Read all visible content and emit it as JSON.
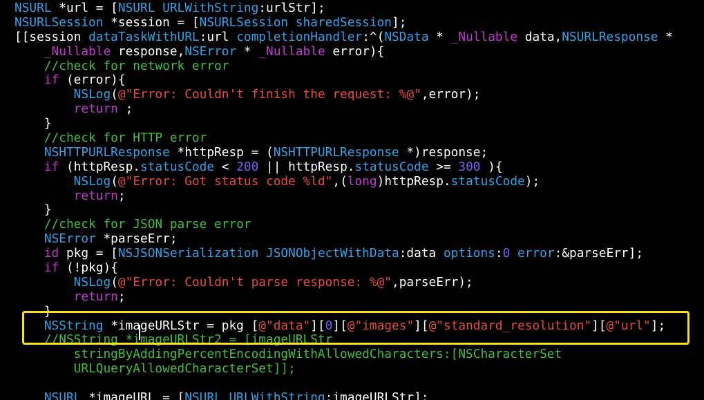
{
  "editor": {
    "highlight_color": "#f6e21a",
    "background": "#000000",
    "token_colors": {
      "kw": "#c33ad2",
      "cls": "#2fa3e8",
      "str": "#e34a3c",
      "cmt": "#3fbf3f",
      "num": "#6f63f0",
      "plain": "#ffffff"
    },
    "lines": [
      [
        [
          "cls",
          "NSURL"
        ],
        [
          "plain",
          " *url = ["
        ],
        [
          "cls",
          "NSURL URLWithString"
        ],
        [
          "plain",
          ":urlStr];"
        ]
      ],
      [
        [
          "cls",
          "NSURLSession"
        ],
        [
          "plain",
          " *session = ["
        ],
        [
          "cls",
          "NSURLSession sharedSession"
        ],
        [
          "plain",
          "];"
        ]
      ],
      [
        [
          "plain",
          "[[session "
        ],
        [
          "cls",
          "dataTaskWithURL"
        ],
        [
          "plain",
          ":url "
        ],
        [
          "cls",
          "completionHandler"
        ],
        [
          "plain",
          ":^("
        ],
        [
          "cls",
          "NSData"
        ],
        [
          "plain",
          " * "
        ],
        [
          "kw",
          "_Nullable"
        ],
        [
          "plain",
          " data,"
        ],
        [
          "cls",
          "NSURLResponse"
        ],
        [
          "plain",
          " *"
        ]
      ],
      [
        [
          "plain",
          "    "
        ],
        [
          "kw",
          "_Nullable"
        ],
        [
          "plain",
          " response,"
        ],
        [
          "cls",
          "NSError"
        ],
        [
          "plain",
          " * "
        ],
        [
          "kw",
          "_Nullable"
        ],
        [
          "plain",
          " error){"
        ]
      ],
      [
        [
          "plain",
          "    "
        ],
        [
          "cmt",
          "//check for network error"
        ]
      ],
      [
        [
          "plain",
          "    "
        ],
        [
          "kw",
          "if"
        ],
        [
          "plain",
          " (error){"
        ]
      ],
      [
        [
          "plain",
          "        "
        ],
        [
          "cls",
          "NSLog"
        ],
        [
          "plain",
          "("
        ],
        [
          "str",
          "@\"Error: Couldn't finish the request: %@\""
        ],
        [
          "plain",
          ",error);"
        ]
      ],
      [
        [
          "plain",
          "        "
        ],
        [
          "kw",
          "return"
        ],
        [
          "plain",
          " ;"
        ]
      ],
      [
        [
          "plain",
          "    }"
        ]
      ],
      [
        [
          "plain",
          "    "
        ],
        [
          "cmt",
          "//check for HTTP error"
        ]
      ],
      [
        [
          "plain",
          "    "
        ],
        [
          "cls",
          "NSHTTPURLResponse"
        ],
        [
          "plain",
          " *httpResp = ("
        ],
        [
          "cls",
          "NSHTTPURLResponse"
        ],
        [
          "plain",
          " *)response;"
        ]
      ],
      [
        [
          "plain",
          "    "
        ],
        [
          "kw",
          "if"
        ],
        [
          "plain",
          " (httpResp."
        ],
        [
          "cls",
          "statusCode"
        ],
        [
          "plain",
          " < "
        ],
        [
          "num",
          "200"
        ],
        [
          "plain",
          " || httpResp."
        ],
        [
          "cls",
          "statusCode"
        ],
        [
          "plain",
          " >= "
        ],
        [
          "num",
          "300"
        ],
        [
          "plain",
          " ){"
        ]
      ],
      [
        [
          "plain",
          "        "
        ],
        [
          "cls",
          "NSLog"
        ],
        [
          "plain",
          "("
        ],
        [
          "str",
          "@\"Error: Got status code %ld\""
        ],
        [
          "plain",
          ",("
        ],
        [
          "kw",
          "long"
        ],
        [
          "plain",
          ")httpResp."
        ],
        [
          "cls",
          "statusCode"
        ],
        [
          "plain",
          ");"
        ]
      ],
      [
        [
          "plain",
          "        "
        ],
        [
          "kw",
          "return"
        ],
        [
          "plain",
          ";"
        ]
      ],
      [
        [
          "plain",
          "    }"
        ]
      ],
      [
        [
          "plain",
          "    "
        ],
        [
          "cmt",
          "//check for JSON parse error"
        ]
      ],
      [
        [
          "plain",
          "    "
        ],
        [
          "cls",
          "NSError"
        ],
        [
          "plain",
          " *parseErr;"
        ]
      ],
      [
        [
          "plain",
          "    "
        ],
        [
          "kw",
          "id"
        ],
        [
          "plain",
          " pkg = ["
        ],
        [
          "cls",
          "NSJSONSerialization JSONObjectWithData"
        ],
        [
          "plain",
          ":data "
        ],
        [
          "cls",
          "options"
        ],
        [
          "plain",
          ":"
        ],
        [
          "num",
          "0"
        ],
        [
          "plain",
          " "
        ],
        [
          "cls",
          "error"
        ],
        [
          "plain",
          ":&parseErr];"
        ]
      ],
      [
        [
          "plain",
          "    "
        ],
        [
          "kw",
          "if"
        ],
        [
          "plain",
          " (!pkg){"
        ]
      ],
      [
        [
          "plain",
          "        "
        ],
        [
          "cls",
          "NSLog"
        ],
        [
          "plain",
          "("
        ],
        [
          "str",
          "@\"Error: Couldn't parse response: %@\""
        ],
        [
          "plain",
          ",parseErr);"
        ]
      ],
      [
        [
          "plain",
          "        "
        ],
        [
          "kw",
          "return"
        ],
        [
          "plain",
          ";"
        ]
      ],
      [
        [
          "plain",
          "    }"
        ]
      ],
      [
        [
          "plain",
          "    "
        ],
        [
          "cls",
          "NSString"
        ],
        [
          "plain",
          " *imageURLStr = pkg ["
        ],
        [
          "str",
          "@\"data\""
        ],
        [
          "plain",
          "]["
        ],
        [
          "num",
          "0"
        ],
        [
          "plain",
          "]["
        ],
        [
          "str",
          "@\"images\""
        ],
        [
          "plain",
          "]["
        ],
        [
          "str",
          "@\"standard_resolution\""
        ],
        [
          "plain",
          "]["
        ],
        [
          "str",
          "@\"url\""
        ],
        [
          "plain",
          "];"
        ]
      ],
      [
        [
          "plain",
          "    "
        ],
        [
          "cmt",
          "//NSString *imageURLStr2 = [imageURLStr"
        ]
      ],
      [
        [
          "plain",
          "        "
        ],
        [
          "cmt",
          "stringByAddingPercentEncodingWithAllowedCharacters:[NSCharacterSet"
        ]
      ],
      [
        [
          "plain",
          "        "
        ],
        [
          "cmt",
          "URLQueryAllowedCharacterSet]];"
        ]
      ],
      [
        [
          "plain",
          ""
        ]
      ],
      [
        [
          "plain",
          "    "
        ],
        [
          "cls",
          "NSURL"
        ],
        [
          "plain",
          " *imageURL = ["
        ],
        [
          "cls",
          "NSURL URLWithString"
        ],
        [
          "plain",
          ":imageURLStr];"
        ]
      ]
    ]
  }
}
